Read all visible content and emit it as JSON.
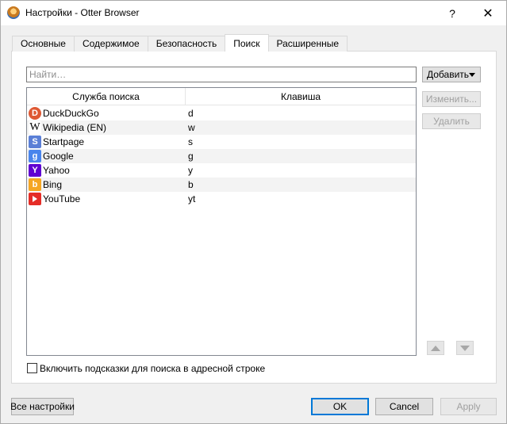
{
  "window": {
    "title": "Настройки - Otter Browser",
    "help_label": "?",
    "close_label": "✕"
  },
  "tabs": [
    {
      "label": "Основные"
    },
    {
      "label": "Содержимое"
    },
    {
      "label": "Безопасность"
    },
    {
      "label": "Поиск",
      "active": true
    },
    {
      "label": "Расширенные"
    }
  ],
  "search": {
    "placeholder": "Найти…",
    "value": ""
  },
  "buttons": {
    "add": "Добавить",
    "edit": "Изменить...",
    "delete": "Удалить"
  },
  "table": {
    "columns": [
      "Служба поиска",
      "Клавиша"
    ],
    "rows": [
      {
        "name": "DuckDuckGo",
        "key": "d",
        "icon": "duckduckgo-icon"
      },
      {
        "name": "Wikipedia (EN)",
        "key": "w",
        "icon": "wikipedia-icon"
      },
      {
        "name": "Startpage",
        "key": "s",
        "icon": "startpage-icon"
      },
      {
        "name": "Google",
        "key": "g",
        "icon": "google-icon"
      },
      {
        "name": "Yahoo",
        "key": "y",
        "icon": "yahoo-icon"
      },
      {
        "name": "Bing",
        "key": "b",
        "icon": "bing-icon"
      },
      {
        "name": "YouTube",
        "key": "yt",
        "icon": "youtube-icon"
      }
    ]
  },
  "checkbox": {
    "label": "Включить подсказки для поиска в адресной строке",
    "checked": false
  },
  "footer": {
    "all_settings": "Все настройки",
    "ok": "OK",
    "cancel": "Cancel",
    "apply": "Apply"
  },
  "icons": {
    "ddg": "D",
    "wiki": "W",
    "startpage": "S",
    "google": "g",
    "yahoo": "Y",
    "bing": "b"
  }
}
